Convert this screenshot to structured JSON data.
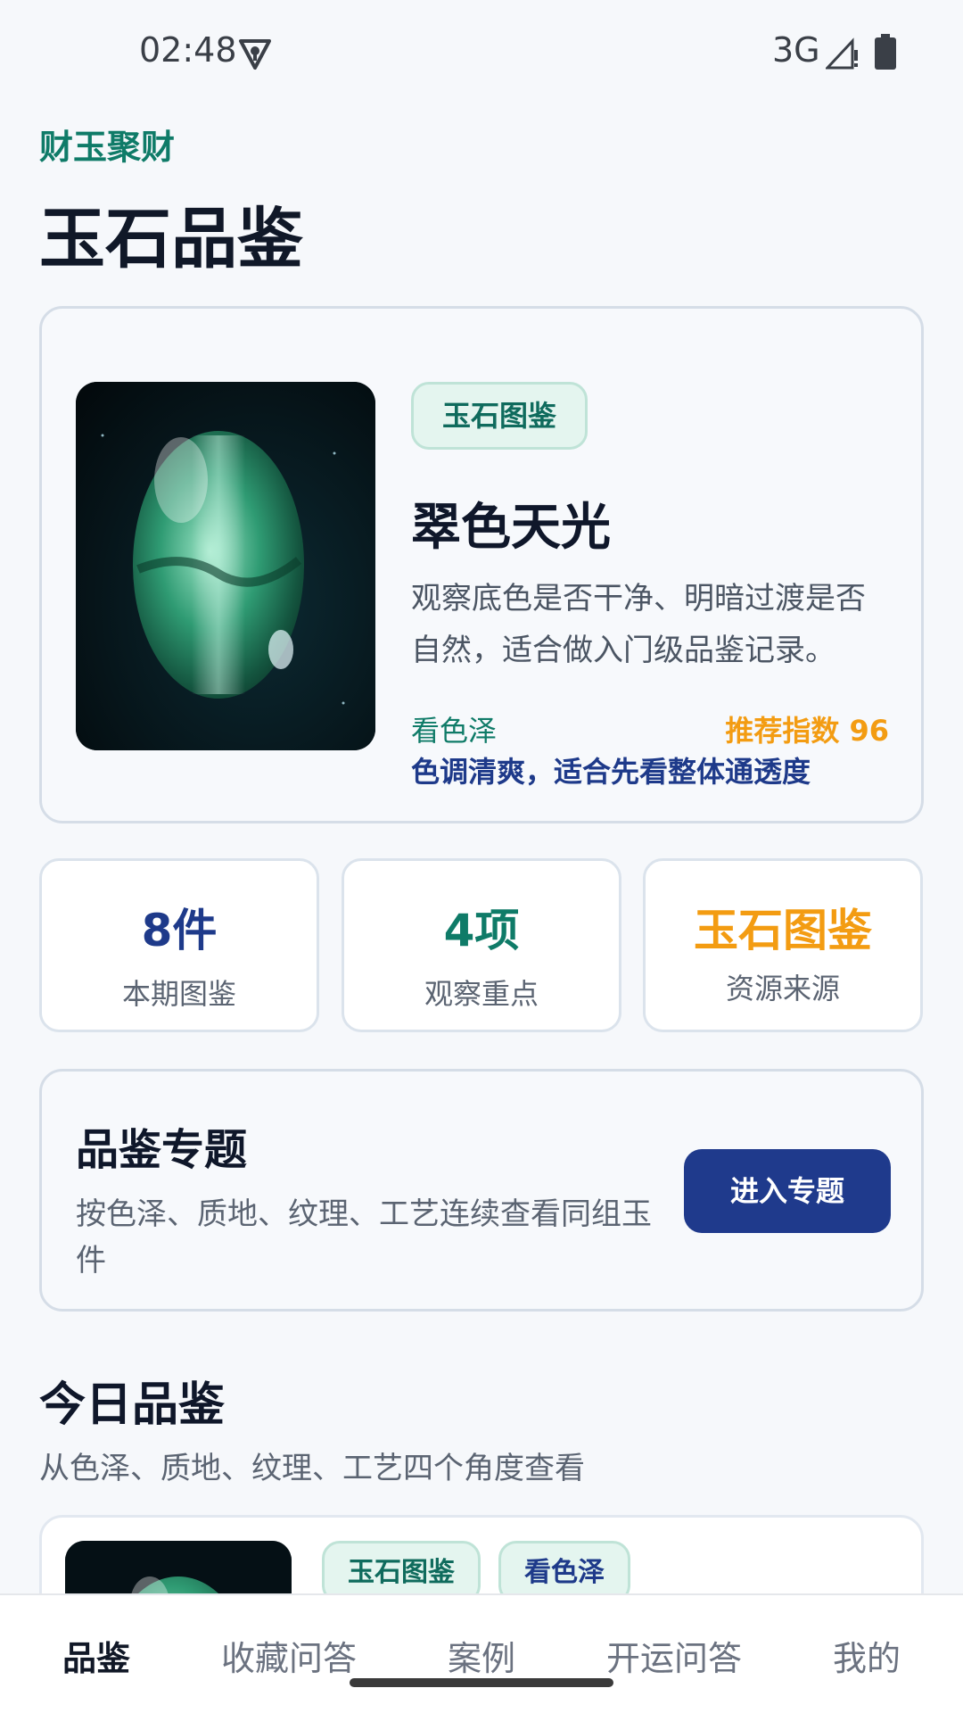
{
  "status_bar": {
    "time": "02:48",
    "network": "3G",
    "icons": [
      "vpn-key-icon",
      "signal-icon",
      "battery-icon"
    ]
  },
  "header": {
    "brand": "财玉聚财",
    "title": "玉石品鉴"
  },
  "hero": {
    "tag": "玉石图鉴",
    "title": "翠色天光",
    "description": "观察底色是否干净、明暗过渡是否自然，适合做入门级品鉴记录。",
    "aspect": "看色泽",
    "score": "推荐指数 96",
    "note": "色调清爽，适合先看整体通透度"
  },
  "stats": [
    {
      "value": "8件",
      "label": "本期图鉴",
      "color": "#1e3a8a"
    },
    {
      "value": "4项",
      "label": "观察重点",
      "color": "#0f7b68"
    },
    {
      "value": "玉石图鉴",
      "label": "资源来源",
      "color": "#f39c12"
    }
  ],
  "topic": {
    "title": "品鉴专题",
    "description": "按色泽、质地、纹理、工艺连续查看同组玉件",
    "button": "进入专题"
  },
  "today": {
    "title": "今日品鉴",
    "subtitle": "从色泽、质地、纹理、工艺四个角度查看",
    "first_item_tags": [
      "玉石图鉴",
      "看色泽"
    ]
  },
  "bottom_nav": [
    "品鉴",
    "收藏问答",
    "案例",
    "开运问答",
    "我的"
  ],
  "colors": {
    "accent_green": "#0f7b68",
    "accent_navy": "#1f3a8c",
    "accent_orange": "#f39c12"
  }
}
